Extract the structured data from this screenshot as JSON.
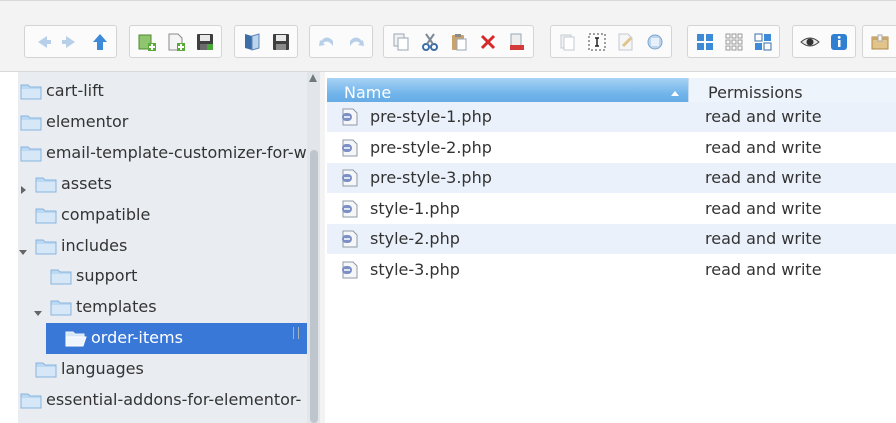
{
  "toolbar": {
    "groups": [
      [
        "back-icon",
        "forward-icon",
        "up-icon"
      ],
      [
        "new-folder-icon",
        "new-file-icon",
        "save-icon"
      ],
      [
        "open-icon",
        "save-as-icon"
      ],
      [
        "undo-icon",
        "redo-icon"
      ],
      [
        "copy-icon",
        "cut-icon",
        "paste-icon",
        "delete-icon",
        "empty-icon"
      ],
      [
        "duplicate-icon",
        "rename-icon",
        "edit-icon",
        "resize-icon"
      ],
      [
        "view-icons-icon",
        "view-list-icon",
        "view-tiles-icon"
      ],
      [
        "preview-icon",
        "info-icon"
      ],
      [
        "extract-icon"
      ]
    ]
  },
  "tree": {
    "nodes": [
      {
        "label": "cart-lift",
        "depth": 0,
        "arrow": "none",
        "selected": false,
        "open": false
      },
      {
        "label": "elementor",
        "depth": 0,
        "arrow": "none",
        "selected": false,
        "open": false
      },
      {
        "label": "email-template-customizer-for-w",
        "depth": 0,
        "arrow": "none",
        "selected": false,
        "open": false
      },
      {
        "label": "assets",
        "depth": 1,
        "arrow": "collapsed",
        "selected": false,
        "open": false
      },
      {
        "label": "compatible",
        "depth": 1,
        "arrow": "none",
        "selected": false,
        "open": false
      },
      {
        "label": "includes",
        "depth": 1,
        "arrow": "expanded",
        "selected": false,
        "open": false
      },
      {
        "label": "support",
        "depth": 2,
        "arrow": "none",
        "selected": false,
        "open": false
      },
      {
        "label": "templates",
        "depth": 2,
        "arrow": "expanded",
        "selected": false,
        "open": false
      },
      {
        "label": "order-items",
        "depth": 3,
        "arrow": "none",
        "selected": true,
        "open": true
      },
      {
        "label": "languages",
        "depth": 1,
        "arrow": "none",
        "selected": false,
        "open": false
      },
      {
        "label": "essential-addons-for-elementor-",
        "depth": 0,
        "arrow": "none",
        "selected": false,
        "open": false
      }
    ]
  },
  "files": {
    "columns": {
      "name": "Name",
      "permissions": "Permissions"
    },
    "sort": "ascending",
    "rows": [
      {
        "name": "pre-style-1.php",
        "permissions": "read and write"
      },
      {
        "name": "pre-style-2.php",
        "permissions": "read and write"
      },
      {
        "name": "pre-style-3.php",
        "permissions": "read and write"
      },
      {
        "name": "style-1.php",
        "permissions": "read and write"
      },
      {
        "name": "style-2.php",
        "permissions": "read and write"
      },
      {
        "name": "style-3.php",
        "permissions": "read and write"
      }
    ]
  },
  "colors": {
    "selection": "#3a78d8",
    "header": "#6fb3ea",
    "row_alt": "#eaf1fb",
    "tree_bg": "#e9edf2"
  }
}
